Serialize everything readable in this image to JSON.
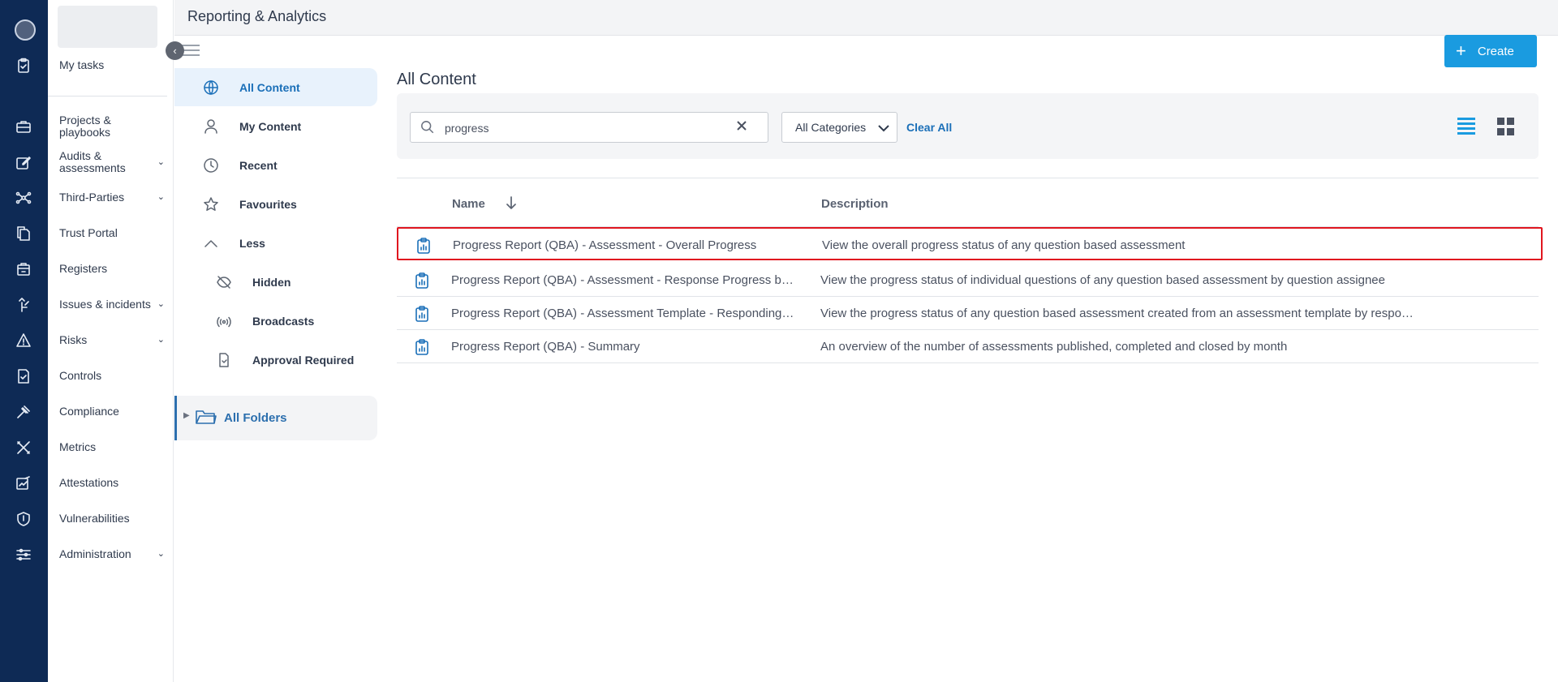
{
  "header": {
    "title": "Reporting & Analytics"
  },
  "nav": {
    "items": [
      {
        "label": "My tasks",
        "has_chevron": false
      },
      {
        "label": "Projects & playbooks",
        "has_chevron": false
      },
      {
        "label": "Audits & assessments",
        "has_chevron": true
      },
      {
        "label": "Third-Parties",
        "has_chevron": true
      },
      {
        "label": "Trust Portal",
        "has_chevron": false
      },
      {
        "label": "Registers",
        "has_chevron": false
      },
      {
        "label": "Issues & incidents",
        "has_chevron": true
      },
      {
        "label": "Risks",
        "has_chevron": true
      },
      {
        "label": "Controls",
        "has_chevron": false
      },
      {
        "label": "Compliance",
        "has_chevron": false
      },
      {
        "label": "Metrics",
        "has_chevron": false
      },
      {
        "label": "Attestations",
        "has_chevron": false
      },
      {
        "label": "Vulnerabilities",
        "has_chevron": false
      },
      {
        "label": "Administration",
        "has_chevron": true
      }
    ],
    "chevron": "⌄"
  },
  "subnav": {
    "items": [
      {
        "label": "All Content",
        "icon": "globe-icon",
        "active": true
      },
      {
        "label": "My Content",
        "icon": "user-icon"
      },
      {
        "label": "Recent",
        "icon": "clock-icon"
      },
      {
        "label": "Favourites",
        "icon": "star-icon"
      },
      {
        "label": "Less",
        "icon": "chevron-up-icon"
      },
      {
        "label": "Hidden",
        "icon": "eye-off-icon"
      },
      {
        "label": "Broadcasts",
        "icon": "broadcast-icon"
      },
      {
        "label": "Approval Required",
        "icon": "file-check-icon"
      }
    ],
    "folders_label": "All Folders"
  },
  "toolbar": {
    "create_label": "Create",
    "create_icon": "+"
  },
  "main": {
    "title": "All Content",
    "search": {
      "value": "progress",
      "placeholder": ""
    },
    "category_select": "All Categories",
    "clear_all": "Clear All"
  },
  "table": {
    "columns": [
      "Name",
      "Description"
    ],
    "rows": [
      {
        "name": "Progress Report (QBA) - Assessment - Overall Progress",
        "description": "View the overall progress status of any question based assessment",
        "highlighted": true
      },
      {
        "name": "Progress Report (QBA) - Assessment - Response Progress by …",
        "description": "View the progress status of individual questions of any question based assessment by question assignee"
      },
      {
        "name": "Progress Report (QBA) - Assessment Template - Responding …",
        "description": "View the progress status of any question based assessment created from an assessment template by respo…"
      },
      {
        "name": "Progress Report (QBA) - Summary",
        "description": "An overview of the number of assessments published, completed and closed by month"
      }
    ]
  },
  "colors": {
    "rail": "#0e2a55",
    "accent": "#1a9be0",
    "link": "#1a6fb8",
    "highlight": "#e0161f"
  }
}
